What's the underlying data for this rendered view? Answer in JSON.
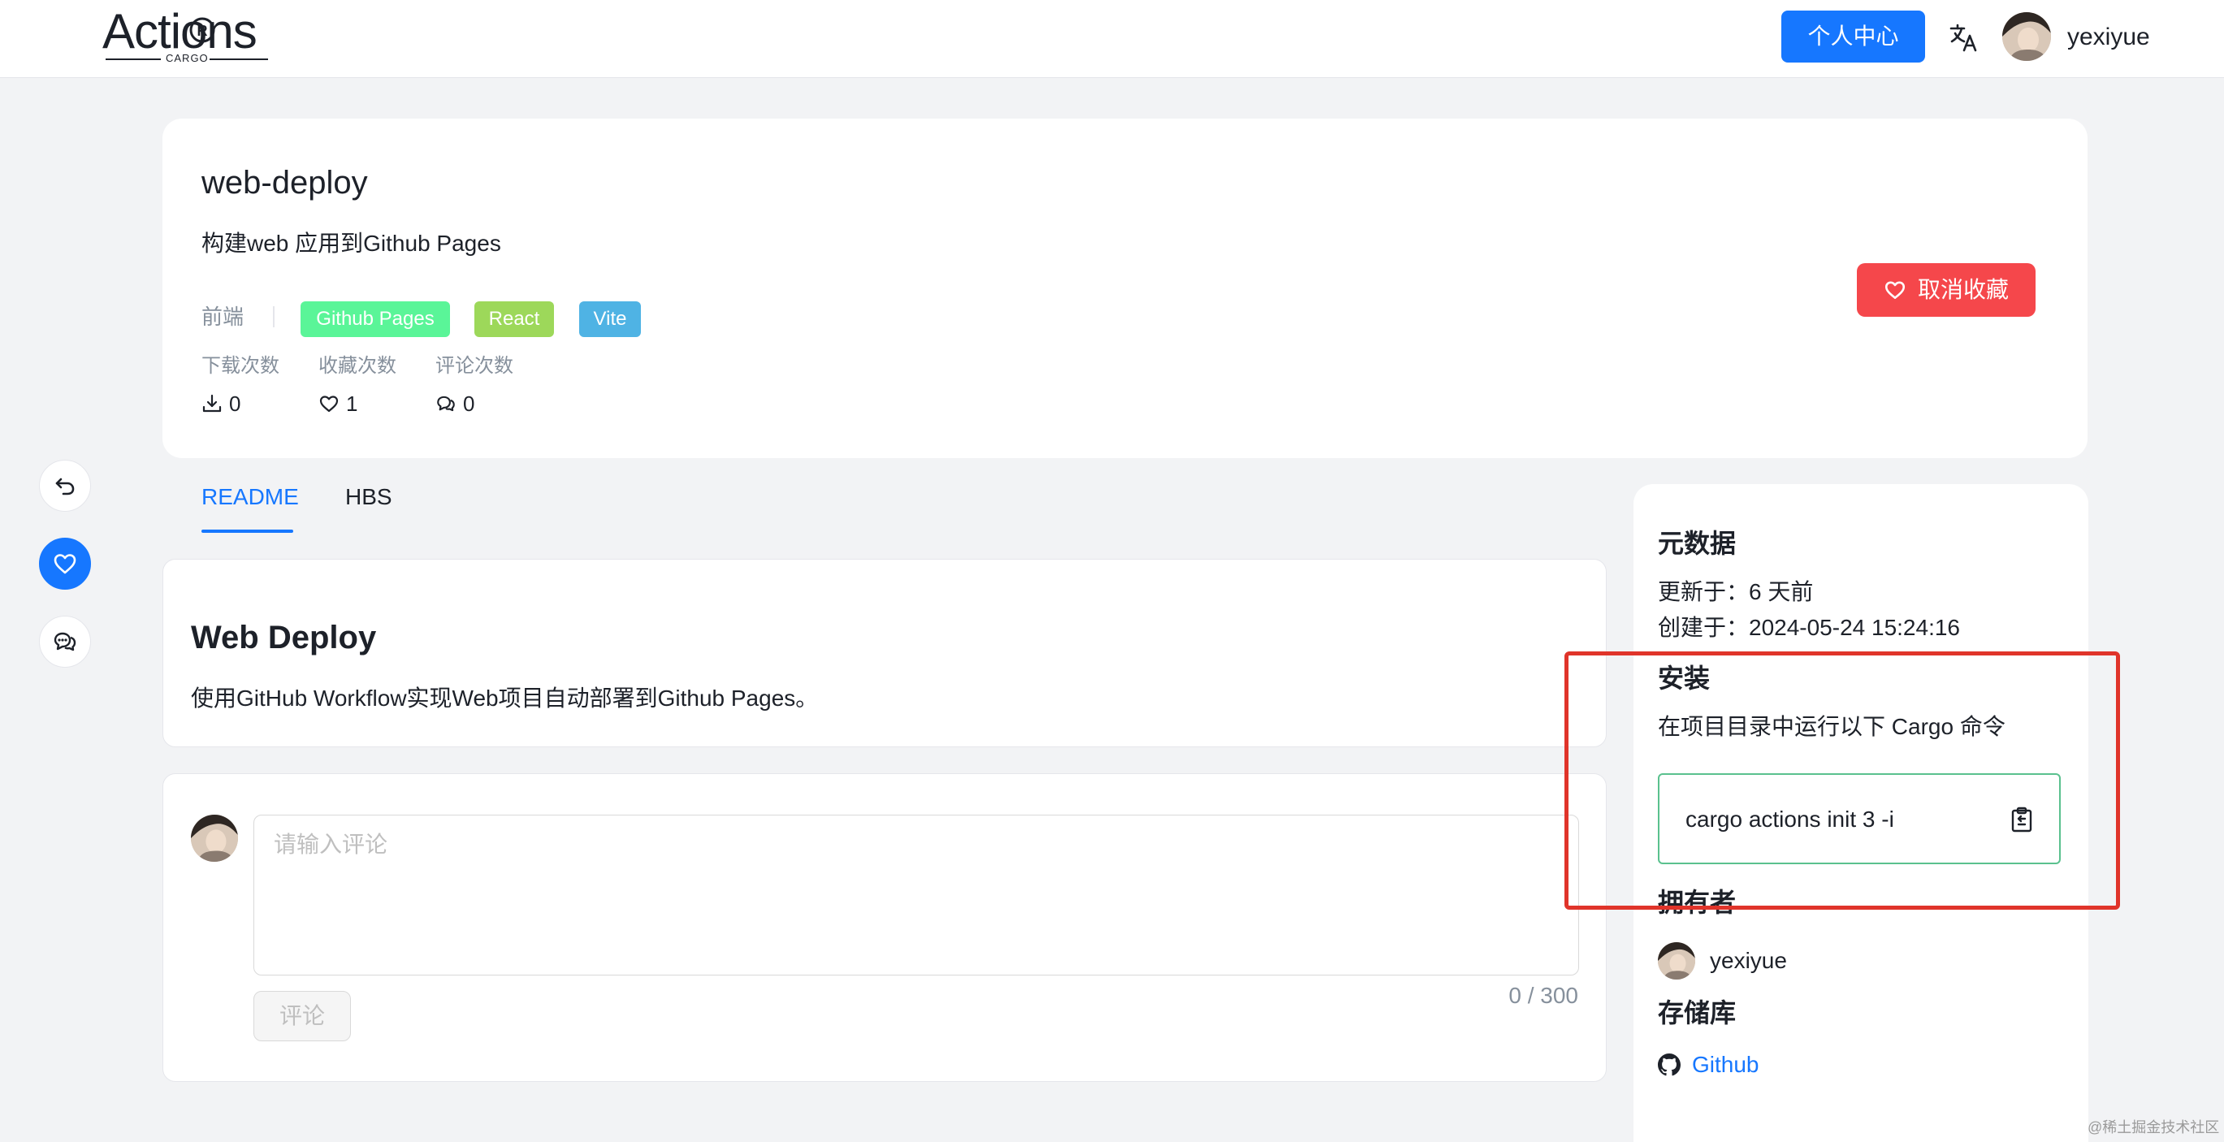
{
  "header": {
    "logo_text": "Actions",
    "logo_sub": "CARGO",
    "personal_center_label": "个人中心",
    "username": "yexiyue"
  },
  "package": {
    "name": "web-deploy",
    "description": "构建web 应用到Github Pages",
    "category": "前端",
    "tags": [
      {
        "label": "Github Pages",
        "color": "#5af598"
      },
      {
        "label": "React",
        "color": "#9dd85a"
      },
      {
        "label": "Vite",
        "color": "#4fb3e4"
      }
    ],
    "stats": {
      "downloads_label": "下载次数",
      "downloads": "0",
      "favorites_label": "收藏次数",
      "favorites": "1",
      "comments_label": "评论次数",
      "comments": "0"
    },
    "unfavorite_label": "取消收藏"
  },
  "tabs": [
    {
      "label": "README",
      "active": true
    },
    {
      "label": "HBS",
      "active": false
    }
  ],
  "readme": {
    "heading": "Web Deploy",
    "paragraph": "使用GitHub Workflow实现Web项目自动部署到Github Pages。"
  },
  "comment": {
    "placeholder": "请输入评论",
    "char_count": "0 / 300",
    "submit_label": "评论"
  },
  "sidebar": {
    "metadata_title": "元数据",
    "updated": "更新于：6 天前",
    "created": "创建于：2024-05-24 15:24:16",
    "install_title": "安装",
    "install_desc": "在项目目录中运行以下 Cargo 命令",
    "install_command": "cargo actions init 3 -i",
    "owner_title": "拥有者",
    "owner_name": "yexiyue",
    "repo_title": "存储库",
    "repo_link": "Github"
  },
  "colors": {
    "primary": "#1677ff",
    "danger": "#f5474b",
    "highlight": "#e0342a",
    "command_border": "#5ac18e"
  },
  "watermark": "@稀土掘金技术社区"
}
